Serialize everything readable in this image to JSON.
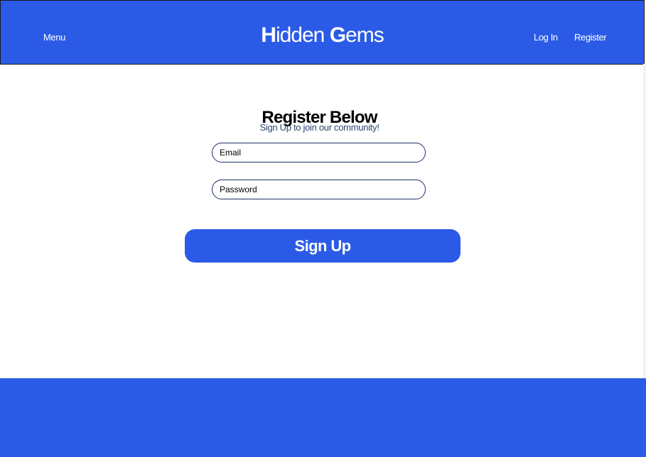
{
  "header": {
    "menu_label": "Menu",
    "brand_first_initial": "H",
    "brand_first_rest": "idden ",
    "brand_second_initial": "G",
    "brand_second_rest": "ems",
    "login_label": "Log In",
    "register_label": "Register"
  },
  "form": {
    "title": "Register Below",
    "subtitle": "Sign Up to join our community!",
    "email_placeholder": "Email",
    "password_placeholder": "Password",
    "submit_label": "Sign Up"
  },
  "colors": {
    "primary": "#2b5be6",
    "text_dark": "#000000",
    "subtitle": "#31456f",
    "field_border": "#1f2f62"
  }
}
